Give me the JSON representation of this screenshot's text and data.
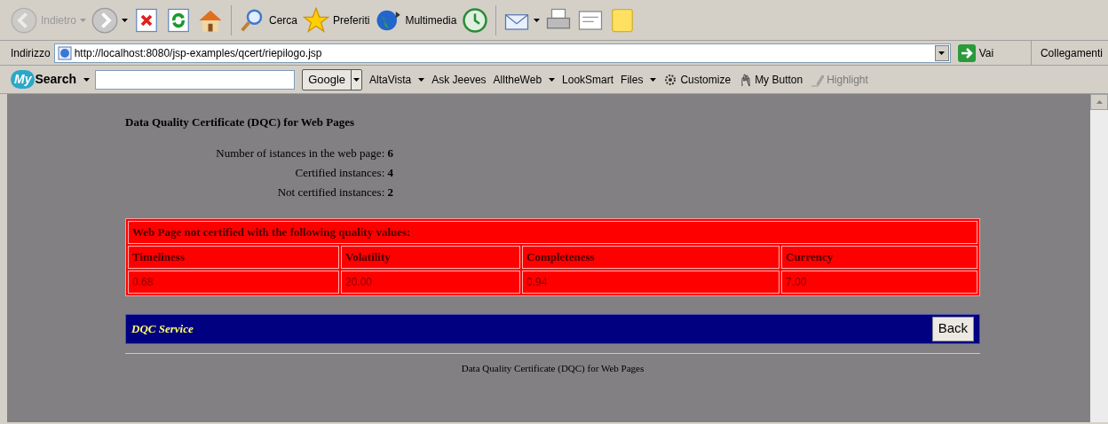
{
  "toolbar": [
    {
      "kind": "nav",
      "label": "Indietro",
      "disabled": true
    },
    {
      "kind": "nav",
      "disabled": false
    },
    {
      "kind": "icon"
    },
    {
      "kind": "icon"
    },
    {
      "kind": "icon"
    },
    {
      "kind": "sep"
    },
    {
      "kind": "button",
      "label": "Cerca"
    },
    {
      "kind": "button",
      "label": "Preferiti"
    },
    {
      "kind": "button",
      "label": "Multimedia"
    },
    {
      "kind": "icon"
    },
    {
      "kind": "sep"
    },
    {
      "kind": "nav",
      "disabled": false
    },
    {
      "kind": "icon"
    },
    {
      "kind": "icon"
    },
    {
      "kind": "icon"
    }
  ],
  "address_bar": {
    "label": "Indirizzo",
    "url": "http://localhost:8080/jsp-examples/qcert/riepilogo.jsp",
    "go": "Vai",
    "links": "Collegamenti"
  },
  "search_bar": {
    "logo_my": "My",
    "logo": "Search",
    "engine": "Google",
    "items": [
      {
        "label": "AltaVista",
        "dropdown": true,
        "disabled": false
      },
      {
        "label": "Ask Jeeves",
        "dropdown": false,
        "disabled": false
      },
      {
        "label": "AlltheWeb",
        "dropdown": true,
        "disabled": false
      },
      {
        "label": "LookSmart",
        "dropdown": false,
        "disabled": false
      },
      {
        "label": "Files",
        "dropdown": true,
        "disabled": false
      },
      {
        "label": "Customize",
        "dropdown": false,
        "disabled": false
      },
      {
        "label": "My Button",
        "dropdown": false,
        "disabled": false
      },
      {
        "label": "Highlight",
        "dropdown": false,
        "disabled": true
      }
    ]
  },
  "page": {
    "title": "Data Quality Certificate (DQC) for Web Pages",
    "stats": [
      {
        "label": "Number of istances in the web page:",
        "value": "6"
      },
      {
        "label": "Certified instances:",
        "value": "4"
      },
      {
        "label": "Not certified instances:",
        "value": "2"
      }
    ],
    "table": {
      "caption": "Web Page not certified with the following quality values:",
      "columns": [
        "Timeliness",
        "Volatility",
        "Completeness",
        "Currency"
      ],
      "rows": [
        [
          "0.68",
          "20.00",
          "0.94",
          "7.00"
        ]
      ]
    },
    "service_bar": {
      "title": "DQC Service",
      "button": "Back"
    },
    "footer": "Data Quality Certificate (DQC) for Web Pages"
  }
}
